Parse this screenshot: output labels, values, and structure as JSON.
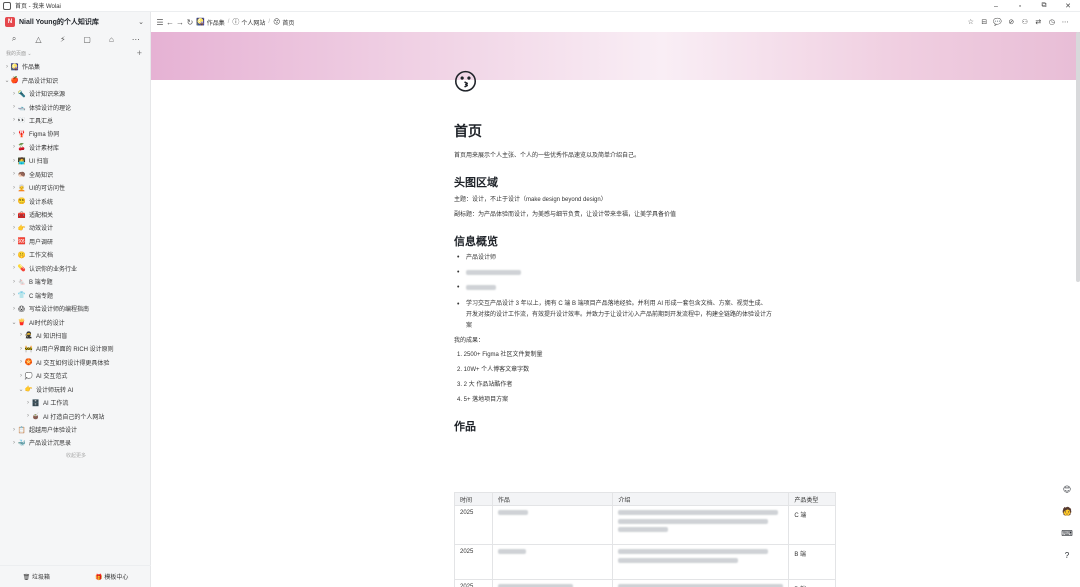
{
  "window": {
    "title": "首页 - 我来 Wolai",
    "controls": [
      "–",
      "▫",
      "⧉",
      "✕"
    ]
  },
  "workspace": {
    "logo_letter": "N",
    "name": "Niall Young的个人知识库",
    "caret": "⌄"
  },
  "sidebar": {
    "tools": [
      "⌕",
      "△",
      "⚡",
      "▢",
      "⌂",
      "⋯"
    ],
    "section_label": "我的页面 ⌄",
    "add_label": "+",
    "items": [
      {
        "arrow": "›",
        "emoji": "🎑",
        "label": "作品集"
      },
      {
        "arrow": "⌄",
        "emoji": "🍎",
        "label": "产品设计知识"
      },
      {
        "arrow": "›",
        "emoji": "🔦",
        "label": "设计知识来源"
      },
      {
        "arrow": "›",
        "emoji": "🛥️",
        "label": "体验设计的理论"
      },
      {
        "arrow": "›",
        "emoji": "👀",
        "label": "工具汇总"
      },
      {
        "arrow": "›",
        "emoji": "🦞",
        "label": "Figma 协同"
      },
      {
        "arrow": "›",
        "emoji": "🍒",
        "label": "设计素材库"
      },
      {
        "arrow": "›",
        "emoji": "🧑‍💻",
        "label": "UI 扫盲"
      },
      {
        "arrow": "›",
        "emoji": "🦔",
        "label": "全局知识"
      },
      {
        "arrow": "›",
        "emoji": "🧑‍🦳",
        "label": "UI的可访问性"
      },
      {
        "arrow": "›",
        "emoji": "😵‍💫",
        "label": "设计系统"
      },
      {
        "arrow": "›",
        "emoji": "🧰",
        "label": "适配相关"
      },
      {
        "arrow": "›",
        "emoji": "👉",
        "label": "动效设计"
      },
      {
        "arrow": "›",
        "emoji": "🆘",
        "label": "用户调研"
      },
      {
        "arrow": "›",
        "emoji": "🤫",
        "label": "工作文档"
      },
      {
        "arrow": "›",
        "emoji": "💊",
        "label": "认识你的业务行业"
      },
      {
        "arrow": "›",
        "emoji": "🐁",
        "label": "B 端专题"
      },
      {
        "arrow": "›",
        "emoji": "👕",
        "label": "C 端专题"
      },
      {
        "arrow": "›",
        "emoji": "😱",
        "label": "写给设计师的编程指南"
      },
      {
        "arrow": "⌄",
        "emoji": "🍟",
        "label": "AI时代的设计"
      },
      {
        "arrow": "›",
        "emoji": "🥷",
        "label": "AI 知识扫盲"
      },
      {
        "arrow": "›",
        "emoji": "🚧",
        "label": "AI用户界面的 RICH 设计原则"
      },
      {
        "arrow": "›",
        "emoji": "🏵️",
        "label": "AI 交互如何设计得更具体验"
      },
      {
        "arrow": "›",
        "emoji": "💭",
        "label": "AI 交互范式"
      },
      {
        "arrow": "⌄",
        "emoji": "👉",
        "label": "设计师玩转 AI"
      },
      {
        "arrow": "›",
        "emoji": "🗄️",
        "label": "AI 工作流"
      },
      {
        "arrow": "›",
        "emoji": "🧉",
        "label": "AI 打造自己的个人网站"
      },
      {
        "arrow": "›",
        "emoji": "📋",
        "label": "超越用户体验设计"
      },
      {
        "arrow": "›",
        "emoji": "🐳",
        "label": "产品设计沉思录"
      }
    ],
    "more_label": "收起更多",
    "bottom": {
      "trash": "🗑 垃圾箱",
      "templates": "🎁 模板中心"
    }
  },
  "topbar": {
    "nav": [
      "☰",
      "←",
      "→",
      "↻"
    ],
    "breadcrumbs": [
      {
        "icon": "🎑",
        "label": "作品集"
      },
      {
        "icon": "ⓘ",
        "label": "个人网站"
      },
      {
        "icon": "😗",
        "label": "首页"
      }
    ],
    "separator": "/",
    "actions": [
      "☆",
      "⊟",
      "💬",
      "⊘",
      "⚇",
      "⇄",
      "◷",
      "⋯"
    ]
  },
  "page": {
    "emoji": "😗",
    "title": "首页",
    "intro": "首页用来展示个人主张、个人的一些优秀作品速览以及简单介绍自己。",
    "section1": {
      "heading": "头图区域",
      "line1": "主题：设计，不止于设计（make design beyond design）",
      "line2": "副标题：为产品体验而设计，为美感与细节负责，让设计带来幸福，让美学具备价值"
    },
    "section2": {
      "heading": "信息概览",
      "bullet1": "产品设计师",
      "bullet4": "学习交互产品设计 3 年以上，拥有 C 端 B 端项目产品落地经验。并利用 AI 形成一套包含文档、方案、视觉生成、开发对接的设计工作流，有效提升设计效率。并致力于让设计沁入产品前期到开发流程中，构建全链路的体验设计方案",
      "achievements_label": "我的成果：",
      "achievements": [
        "2500+ Figma 社区文件复制量",
        "10W+ 个人博客文章字数",
        "2 大 作品站酷作者",
        "5+ 落地项目方案"
      ]
    },
    "section3": {
      "heading": "作品",
      "columns": [
        "时间",
        "作品",
        "介绍",
        "产品类型"
      ],
      "rows": [
        {
          "year": "2025",
          "type": "C 端"
        },
        {
          "year": "2025",
          "type": "B 端"
        },
        {
          "year": "2025",
          "type": "B 端"
        }
      ]
    }
  },
  "right_float": [
    "😊",
    "🧑",
    "⌨",
    "?"
  ],
  "colors": {
    "accent": "#e5484d",
    "sidebar_bg": "#f5f6f7",
    "cover": "#e6b2d4"
  }
}
